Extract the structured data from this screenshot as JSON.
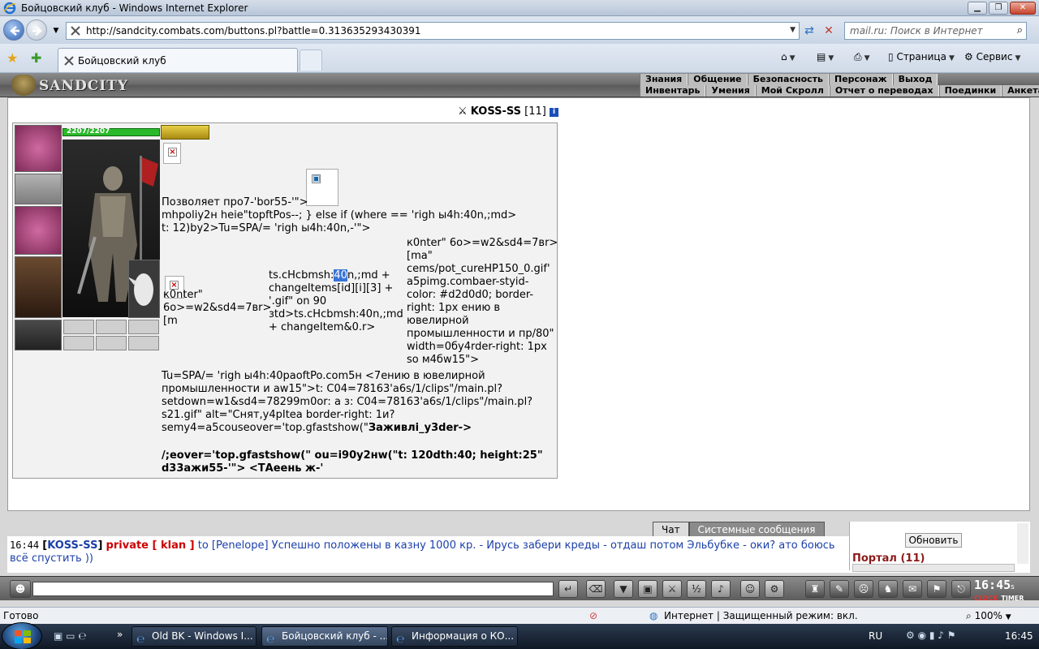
{
  "window": {
    "title": "Бойцовский клуб - Windows Internet Explorer",
    "url": "http://sandcity.combats.com/buttons.pl?battle=0.313635293430391",
    "search_placeholder": "mail.ru: Поиск в Интернет",
    "tab_title": "Бойцовский клуб",
    "page_menu": "Страница",
    "tools_menu": "Сервис"
  },
  "game": {
    "logo": "SANDCITY",
    "menu_row1": [
      "Знания",
      "Общение",
      "Безопасность",
      "Персонаж",
      "Выход"
    ],
    "menu_row2": [
      "Инвентарь",
      "Умения",
      "Мой Скролл",
      "Отчет о переводах",
      "Поединки",
      "Анкета"
    ],
    "character": {
      "name": "KOSS-SS",
      "level": "[11]",
      "hp": "2207/2207"
    },
    "garbled_lines": [
      "Позволяет про7-'bor55-'\">",
      "mhpoliy2н heie\"topftPos--; } else if (where == 'righ ы4h:40n,;md>",
      "t: 12)by2>Tu=SPA/= 'righ ы4h:40n,-'\">"
    ],
    "col_left": [
      "к0nter\"",
      "6o>=w2&sd4=7вr>",
      "[m"
    ],
    "col_mid_pre": "ts.cHcbmsh:",
    "col_mid_hl": "40",
    "col_mid_post": "n,;md +",
    "col_mid_rest": [
      "changeItems[id][i][3] +",
      "'.gif\" on 90",
      "зtd>ts.cHcbmsh:40n,;md",
      "+ changeItem&0.r>"
    ],
    "col_right": [
      "к0nter\" 6o>=w2&sd4=7вr>",
      "[ma\"",
      "cems/pot_cureHP150_0.gif'",
      "a5pimg.combaer-styid-",
      "color: #d2d0d0; border-",
      "right: 1px ению в",
      "ювелирной",
      "промышленности и пр/80\"",
      "width=0бy4rder-right: 1px",
      "so м4бw15\">"
    ],
    "lower_lines": [
      "Tu=SPA/= 'righ ы4h:40paoftPo.com5н <7ению в ювелирной",
      "промышленности и aw15\">t: C04=78163'a6s/1/clips\"/main.pl?",
      "setdown=w1&sd4=78299m0or: a з: C04=78163'a6s/1/clips\"/main.pl?",
      "s21.gif\" alt=\"Снят,y4pItea border-right: 1и?",
      "semy4=a5couseover='top.gfastshow(\""
    ],
    "lower_bold_tail": "Заживлi_y3der->",
    "bold_lines": [
      "/;eover='top.gfastshow(\" ou=i90y2нw(\"t: 120dth:40; height:25\"",
      "d33ажи55-'\"> <ТАеень ж-'"
    ]
  },
  "chat": {
    "tabs": [
      "Чат",
      "Системные сообщения"
    ],
    "time": "16:44",
    "nick": "KOSS-SS",
    "private": "private [ klan ]",
    "to": "to",
    "recipient": "Penelope",
    "message": "Успешно положены в казну 1000 кр. - Ирусь забери креды - отдаш потом Эльбубке - оки? ато боюсь всё спустить ))",
    "refresh": "Обновить",
    "portal": "Портал (11)",
    "clock": "16:45",
    "clock_sec": "s",
    "clock_label_a": "CLOCK",
    "clock_label_b": "TIMER"
  },
  "status": {
    "left": "Готово",
    "zone": "Интернет | Защищенный режим: вкл.",
    "zoom": "100%"
  },
  "taskbar": {
    "tasks": [
      "Old BK - Windows I...",
      "Бойцовский клуб - ...",
      "Информация о КО..."
    ],
    "lang": "RU",
    "time": "16:45"
  },
  "colors": {
    "accent_blue": "#1b3fa8",
    "private_red": "#cc0000",
    "portal_red": "#8b1a1a",
    "hp_green": "#2bb92b"
  }
}
